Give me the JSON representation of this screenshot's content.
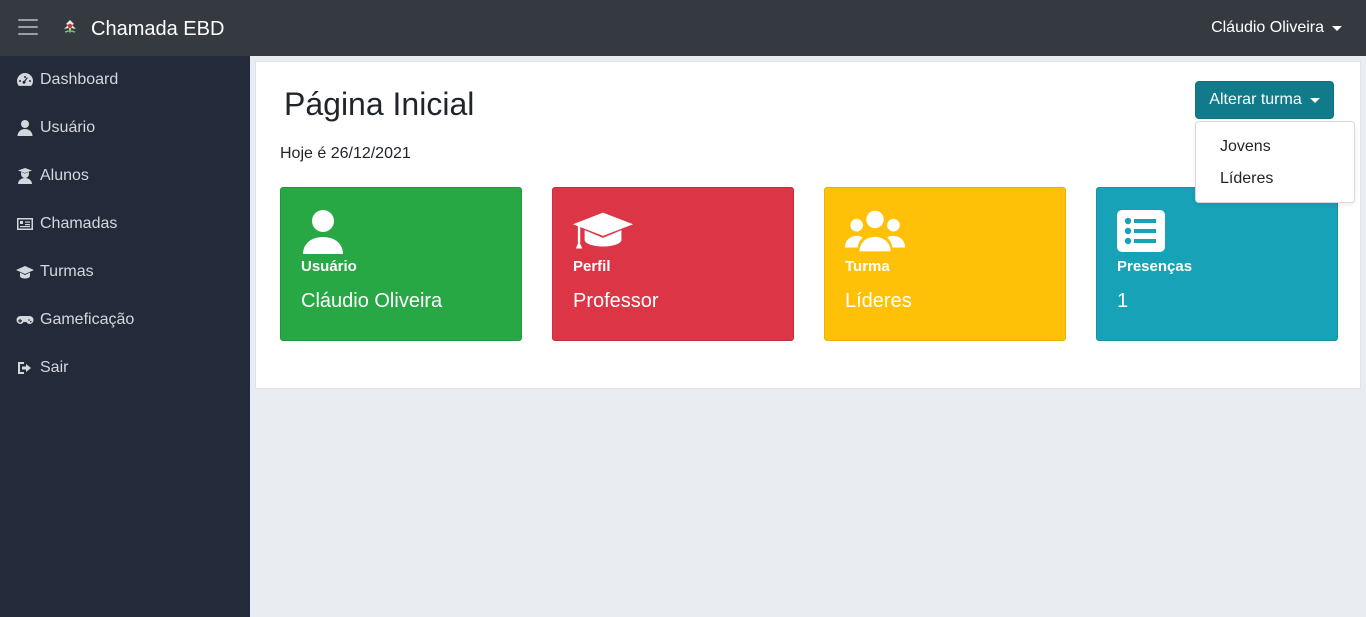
{
  "navbar": {
    "brand": "Chamada EBD",
    "user_name": "Cláudio Oliveira"
  },
  "sidebar": {
    "items": [
      {
        "label": "Dashboard",
        "icon": "tachometer-icon"
      },
      {
        "label": "Usuário",
        "icon": "user-icon"
      },
      {
        "label": "Alunos",
        "icon": "user-graduate-icon"
      },
      {
        "label": "Chamadas",
        "icon": "id-card-icon"
      },
      {
        "label": "Turmas",
        "icon": "graduation-cap-icon"
      },
      {
        "label": "Gameficação",
        "icon": "gamepad-icon"
      },
      {
        "label": "Sair",
        "icon": "sign-out-icon"
      }
    ]
  },
  "main": {
    "title": "Página Inicial",
    "today": "Hoje é 26/12/2021",
    "change_class_button": "Alterar turma",
    "class_options": [
      "Jovens",
      "Líderes"
    ]
  },
  "tiles": [
    {
      "label": "Usuário",
      "value": "Cláudio Oliveira",
      "color": "#28a745",
      "icon": "user-icon"
    },
    {
      "label": "Perfil",
      "value": "Professor",
      "color": "#dc3545",
      "icon": "graduation-cap-icon"
    },
    {
      "label": "Turma",
      "value": "Líderes",
      "color": "#ffc107",
      "icon": "users-icon"
    },
    {
      "label": "Presenças",
      "value": "1",
      "color": "#17a2b8",
      "icon": "list-icon"
    }
  ],
  "colors": {
    "navbar": "#343a40",
    "sidebar": "#232a39",
    "accent_button": "#117a8b"
  }
}
